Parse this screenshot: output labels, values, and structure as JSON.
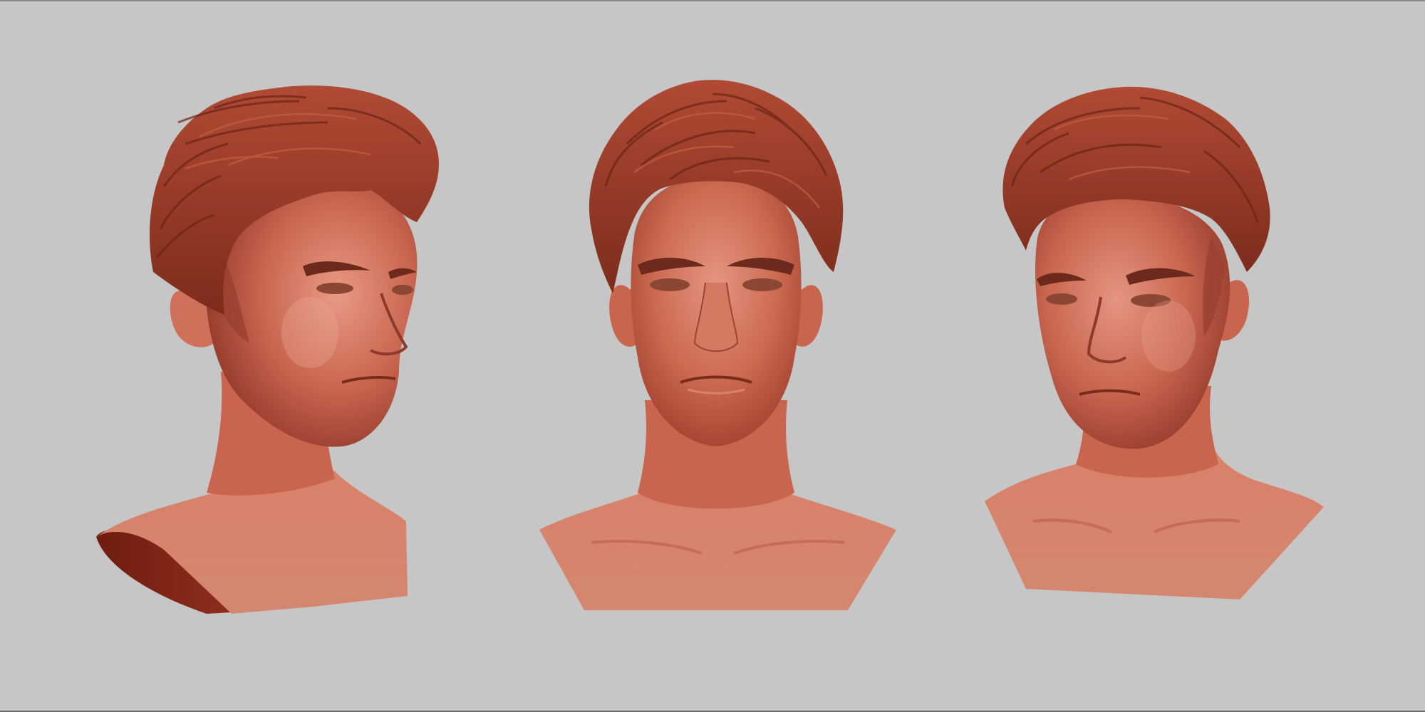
{
  "scene": {
    "background_color": "#c6c6c6",
    "clay_color": "#c4604a",
    "clay_highlight": "#e8a08a",
    "clay_shadow": "#7a2a1a",
    "hair_color": "#9a3a28",
    "views": [
      {
        "name": "three-quarter-left-view"
      },
      {
        "name": "front-view"
      },
      {
        "name": "three-quarter-right-view"
      }
    ]
  }
}
